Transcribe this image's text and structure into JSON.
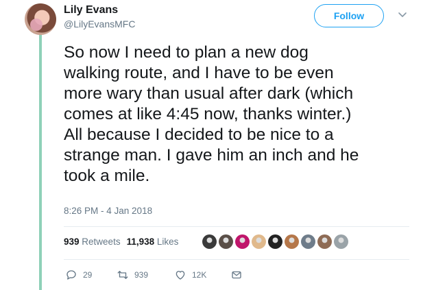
{
  "user": {
    "name": "Lily Evans",
    "handle": "@LilyEvansMFC"
  },
  "follow_label": "Follow",
  "tweet": {
    "text": "So now I need to plan a new dog\nwalking route, and I have to be even\nmore wary than usual after dark (which\ncomes at like 4:45 now, thanks winter.)\nAll because I decided to be nice to a\nstrange man. I gave him an inch and he\ntook a mile.",
    "timestamp": "8:26 PM - 4 Jan 2018"
  },
  "stats": {
    "retweets_count": "939",
    "retweets_label": "Retweets",
    "likes_count": "11,938",
    "likes_label": "Likes"
  },
  "likers": [
    {
      "color": "#3a3a3a"
    },
    {
      "color": "#5a4f48"
    },
    {
      "color": "#c0166b"
    },
    {
      "color": "#e0b98c"
    },
    {
      "color": "#222222"
    },
    {
      "color": "#b5774a"
    },
    {
      "color": "#6e7c8a"
    },
    {
      "color": "#8e6b55"
    },
    {
      "color": "#9aa3a8"
    }
  ],
  "actions": {
    "reply_count": "29",
    "retweet_count": "939",
    "like_count": "12K"
  },
  "colors": {
    "accent": "#1da1f2",
    "muted": "#657786",
    "thread_line": "#8fd1b8"
  },
  "icons": [
    "chevron-down-icon",
    "reply-icon",
    "retweet-icon",
    "like-icon",
    "message-icon"
  ]
}
